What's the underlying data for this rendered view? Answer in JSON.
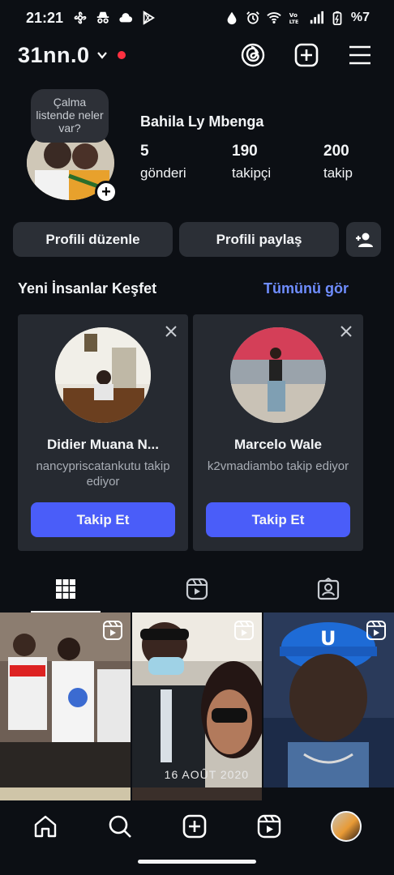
{
  "status_bar": {
    "time": "21:21",
    "battery": "%7",
    "icons": [
      "fan-icon",
      "incognito-icon",
      "cloud-icon",
      "play-store-icon",
      "drop-icon",
      "alarm-icon",
      "wifi-icon",
      "volte-icon",
      "signal-icon",
      "battery-icon"
    ]
  },
  "header": {
    "username": "31nn.0",
    "icons": [
      "threads-icon",
      "create-icon",
      "menu-icon"
    ]
  },
  "profile": {
    "note": "Çalma listende neler var?",
    "display_name": "Bahila Ly Mbenga",
    "stats": [
      {
        "value": "5",
        "label": "gönderi"
      },
      {
        "value": "190",
        "label": "takipçi"
      },
      {
        "value": "200",
        "label": "takip"
      }
    ]
  },
  "actions": {
    "edit_profile": "Profili düzenle",
    "share_profile": "Profili paylaş"
  },
  "discover": {
    "title": "Yeni İnsanlar Keşfet",
    "see_all": "Tümünü gör",
    "cards": [
      {
        "name": "Didier Muana N...",
        "subtitle": "nancypriscatankutu takip ediyor",
        "button": "Takip Et"
      },
      {
        "name": "Marcelo Wale",
        "subtitle": "k2vmadiambo takip ediyor",
        "button": "Takip Et"
      }
    ]
  },
  "tabs": [
    "grid-icon",
    "reels-icon",
    "tagged-icon"
  ],
  "posts": [
    {
      "stamp": ""
    },
    {
      "stamp": "16 AOÛT 2020"
    },
    {
      "stamp": ""
    }
  ],
  "bottom_nav": [
    "home-icon",
    "search-icon",
    "create-icon",
    "reels-icon",
    "profile-avatar"
  ],
  "colors": {
    "background": "#0c0f14",
    "button": "#2b2f36",
    "accent": "#4a5df9",
    "link": "#6f8dff",
    "live_dot": "#ff3040"
  }
}
